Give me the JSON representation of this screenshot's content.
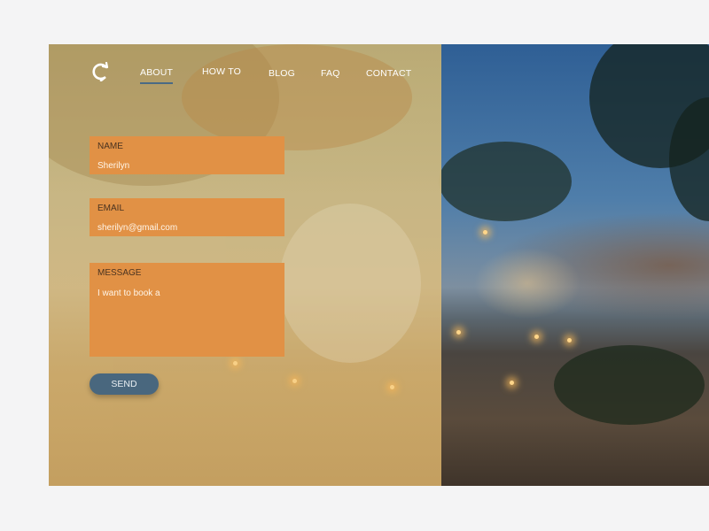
{
  "nav": {
    "logo_icon": "refresh-location-icon",
    "items": [
      {
        "label": "ABOUT",
        "active": true
      },
      {
        "label": "HOW TO",
        "active": false
      },
      {
        "label": "BLOG",
        "active": false
      },
      {
        "label": "FAQ",
        "active": false
      },
      {
        "label": "CONTACT",
        "active": false
      }
    ]
  },
  "form": {
    "name": {
      "label": "NAME",
      "value": "Sherilyn"
    },
    "email": {
      "label": "EMAIL",
      "value": "sherilyn@gmail.com"
    },
    "message": {
      "label": "MESSAGE",
      "value": "I want to book a"
    },
    "send_label": "SEND"
  },
  "colors": {
    "field_bg": "#e19145",
    "button_bg": "#49677e",
    "overlay": "#cdb983",
    "active_underline": "#4a6a85"
  }
}
